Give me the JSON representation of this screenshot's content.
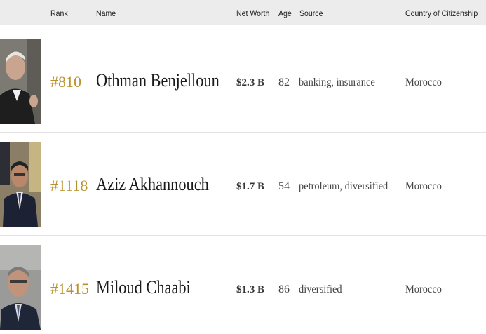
{
  "header": {
    "rank": "Rank",
    "name": "Name",
    "net_worth": "Net Worth",
    "age": "Age",
    "source": "Source",
    "country": "Country of Citizenship"
  },
  "rows": [
    {
      "rank": "#810",
      "name": "Othman Benjelloun",
      "net_worth": "$2.3 B",
      "age": "82",
      "source": "banking, insurance",
      "country": "Morocco"
    },
    {
      "rank": "#1118",
      "name": "Aziz Akhannouch",
      "net_worth": "$1.7 B",
      "age": "54",
      "source": "petroleum, diversified",
      "country": "Morocco"
    },
    {
      "rank": "#1415",
      "name": "Miloud Chaabi",
      "net_worth": "$1.3 B",
      "age": "86",
      "source": "diversified",
      "country": "Morocco"
    }
  ],
  "colors": {
    "rank": "#b8922e",
    "header_bg": "#ececec"
  }
}
